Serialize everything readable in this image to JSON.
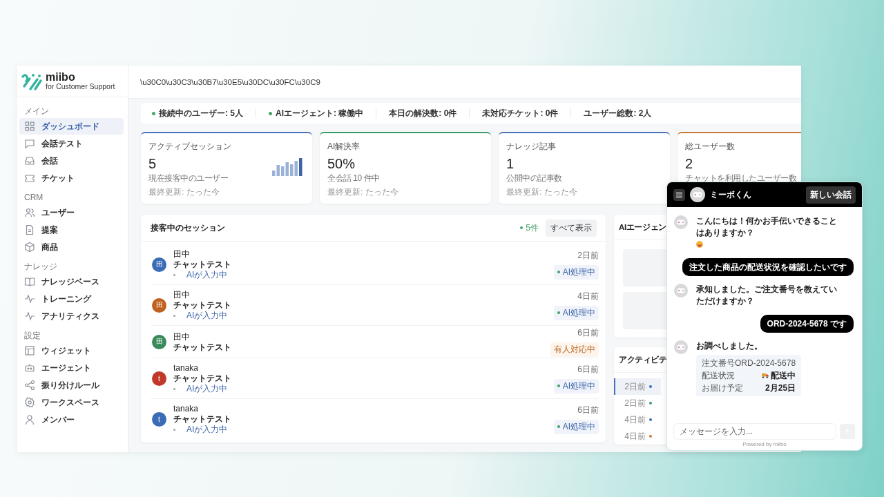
{
  "logo": {
    "name": "miibo",
    "tagline": "for Customer Support"
  },
  "sidebar": {
    "groups": [
      {
        "label": "メイン",
        "items": [
          {
            "label": "ダッシュボード",
            "selected": true
          },
          {
            "label": "会話テスト",
            "selected": false
          },
          {
            "label": "会話",
            "selected": false
          },
          {
            "label": "チケット",
            "selected": false
          }
        ]
      },
      {
        "label": "CRM",
        "items": [
          {
            "label": "ユーザー",
            "selected": false
          },
          {
            "label": "提案",
            "selected": false
          },
          {
            "label": "商品",
            "selected": false
          }
        ]
      },
      {
        "label": "ナレッジ",
        "items": [
          {
            "label": "ナレッジベース",
            "selected": false
          },
          {
            "label": "トレーニング",
            "selected": false
          },
          {
            "label": "アナリティクス",
            "selected": false
          }
        ]
      },
      {
        "label": "設定",
        "items": [
          {
            "label": "ウィジェット",
            "selected": false
          },
          {
            "label": "エージェント",
            "selected": false
          },
          {
            "label": "振り分けルール",
            "selected": false
          },
          {
            "label": "ワークスペース",
            "selected": false
          },
          {
            "label": "メンバー",
            "selected": false
          }
        ]
      }
    ]
  },
  "header": {
    "title": "\\u30C0\\u30C3\\u30B7\\u30E5\\u30DC\\u30FC\\u30C9"
  },
  "status_bar": [
    {
      "label": "接続中のユーザー: 5人",
      "dot": true
    },
    {
      "label": "AIエージェント: 稼働中",
      "dot": true
    },
    {
      "label": "本日の解決数: 0件",
      "dot": false
    },
    {
      "label": "未対応チケット: 0件",
      "dot": false
    },
    {
      "label": "ユーザー総数: 2人",
      "dot": false
    }
  ],
  "stats": [
    {
      "title": "アクティブセッション",
      "value": "5",
      "note": "現在接客中のユーザー",
      "updated": "最終更新: たった今",
      "color": "#4a72b8",
      "sparkline": true
    },
    {
      "title": "AI解決率",
      "value": "50%",
      "note": "全会話 10 件中",
      "updated": "最終更新: たった今",
      "color": "#3a9a6a",
      "sparkline": false
    },
    {
      "title": "ナレッジ記事",
      "value": "1",
      "note": "公開中の記事数",
      "updated": "最終更新: たった今",
      "color": "#4a72b8",
      "sparkline": false
    },
    {
      "title": "総ユーザー数",
      "value": "2",
      "note": "チャットを利用したユーザー数",
      "color": "#c87a3a",
      "sparkline": false
    }
  ],
  "sessions": {
    "title": "接客中のセッション",
    "count": "5件",
    "view_all": "すべて表示",
    "items": [
      {
        "avatar": "田",
        "color": "#3b6cb5",
        "name": "田中",
        "subject": "チャットテスト",
        "typing": "AIが入力中",
        "time": "2日前",
        "status": "AI処理中",
        "kind": "ai"
      },
      {
        "avatar": "田",
        "color": "#c0611f",
        "name": "田中",
        "subject": "チャットテスト",
        "typing": "AIが入力中",
        "time": "4日前",
        "status": "AI処理中",
        "kind": "ai"
      },
      {
        "avatar": "田",
        "color": "#3a8a5a",
        "name": "田中",
        "subject": "チャットテスト",
        "time": "6日前",
        "status": "有人対応中",
        "kind": "human"
      },
      {
        "avatar": "t",
        "color": "#c0392b",
        "name": "tanaka",
        "subject": "チャットテスト",
        "typing": "AIが入力中",
        "time": "6日前",
        "status": "AI処理中",
        "kind": "ai"
      },
      {
        "avatar": "t",
        "color": "#3b6cb5",
        "name": "tanaka",
        "subject": "チャットテスト",
        "typing": "AIが入力中",
        "time": "6日前",
        "status": "AI処理中",
        "kind": "ai"
      }
    ]
  },
  "agent_panel": {
    "title": "AIエージェン"
  },
  "activity": {
    "title": "アクティビテ",
    "items": [
      {
        "time": "2日前",
        "color": "#3b6cb5",
        "selected": true
      },
      {
        "time": "2日前",
        "color": "#3a9a6a",
        "selected": false
      },
      {
        "time": "4日前",
        "color": "#3b6cb5",
        "selected": false
      },
      {
        "time": "4日前",
        "color": "#c87a3a",
        "selected": false
      }
    ]
  },
  "chat": {
    "bot_name": "ミーボくん",
    "new_chat": "新しい会話",
    "messages": [
      {
        "kind": "bot",
        "text": "こんにちは！何かお手伝いできることはありますか？",
        "emoji": true
      },
      {
        "kind": "user",
        "text": "注文した商品の配送状況を確認したいです"
      },
      {
        "kind": "bot",
        "text": "承知しました。ご注文番号を教えていただけますか？",
        "emoji": false
      },
      {
        "kind": "user",
        "text": "ORD-2024-5678 です"
      },
      {
        "kind": "bot",
        "text": "お調べしました。",
        "emoji": false,
        "details": [
          {
            "label": "注文番号ORD-2024-5678"
          },
          {
            "label": "配送状況",
            "value": "配送中",
            "truck": true
          },
          {
            "label": "お届け予定",
            "value": "2月25日",
            "truck": false
          }
        ]
      }
    ],
    "input_placeholder": "メッセージを入力...",
    "powered_by": "Powered by miibo"
  }
}
